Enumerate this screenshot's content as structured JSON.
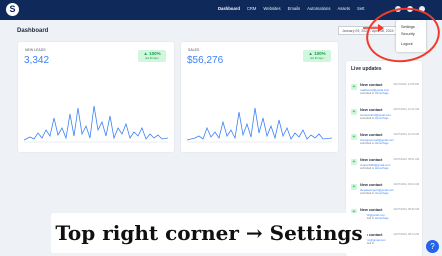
{
  "nav": {
    "logo": "S",
    "items": [
      "Dashboard",
      "CRM",
      "Websites",
      "Emails",
      "Automations",
      "Assets",
      "Sett"
    ],
    "active": "Dashboard"
  },
  "page": {
    "title": "Dashboard",
    "date_range": "January 09, 2024 - April 08, 2024"
  },
  "cards": [
    {
      "label": "NEW LEADS",
      "value": "3,342",
      "pct": "▲ 100%",
      "pct_sub": "last 90 days",
      "color": "#3b82f6"
    },
    {
      "label": "SALES",
      "value": "$56,276",
      "pct": "▲ 100%",
      "pct_sub": "last 90 days",
      "color": "#3b82f6"
    }
  ],
  "live": {
    "title": "Live updates",
    "entries": [
      {
        "title": "New contact",
        "time": "04/07/2024, 12:55 PM",
        "email": "matthews2@gmail.com",
        "by": "submitted to",
        "form": "Home Page"
      },
      {
        "title": "New contact",
        "time": "04/07/2024, 10:21 AM",
        "email": "tomsenrahul@gmail.com",
        "by": "submitted to",
        "form": "Home Page"
      },
      {
        "title": "New contact",
        "time": "04/07/2024, 10:10 AM",
        "email": "chesgreenmail@gmail.com",
        "by": "submitted to",
        "form": "Home Page"
      },
      {
        "title": "New contact",
        "time": "04/07/2024, 09:51 AM",
        "email": "cooper2200@gmail.com",
        "by": "submitted to",
        "form": "Home Page"
      },
      {
        "title": "New contact",
        "time": "04/07/2024, 09:42 AM",
        "email": "thepassengers@gmail.com",
        "by": "submitted to",
        "form": "Home Page"
      },
      {
        "title": "New contact",
        "time": "04/07/2024, 08:30 AM",
        "email": "tm2001@gmail.com",
        "by": "submitted to",
        "form": "Home Page"
      },
      {
        "title": "New contact",
        "time": "04/07/2024, 08:14 AM",
        "email": "ellisgcm@gmail.com",
        "by": "submitted to",
        "form": ""
      }
    ]
  },
  "menu": {
    "items": [
      "Settings",
      "Security",
      "Logout"
    ]
  },
  "caption": "Top right corner → Settings",
  "help": "?",
  "colors": {
    "nav": "#0f2a5a",
    "accent": "#3b82f6",
    "highlight": "#ef3b2c",
    "success": "#16a34a"
  }
}
